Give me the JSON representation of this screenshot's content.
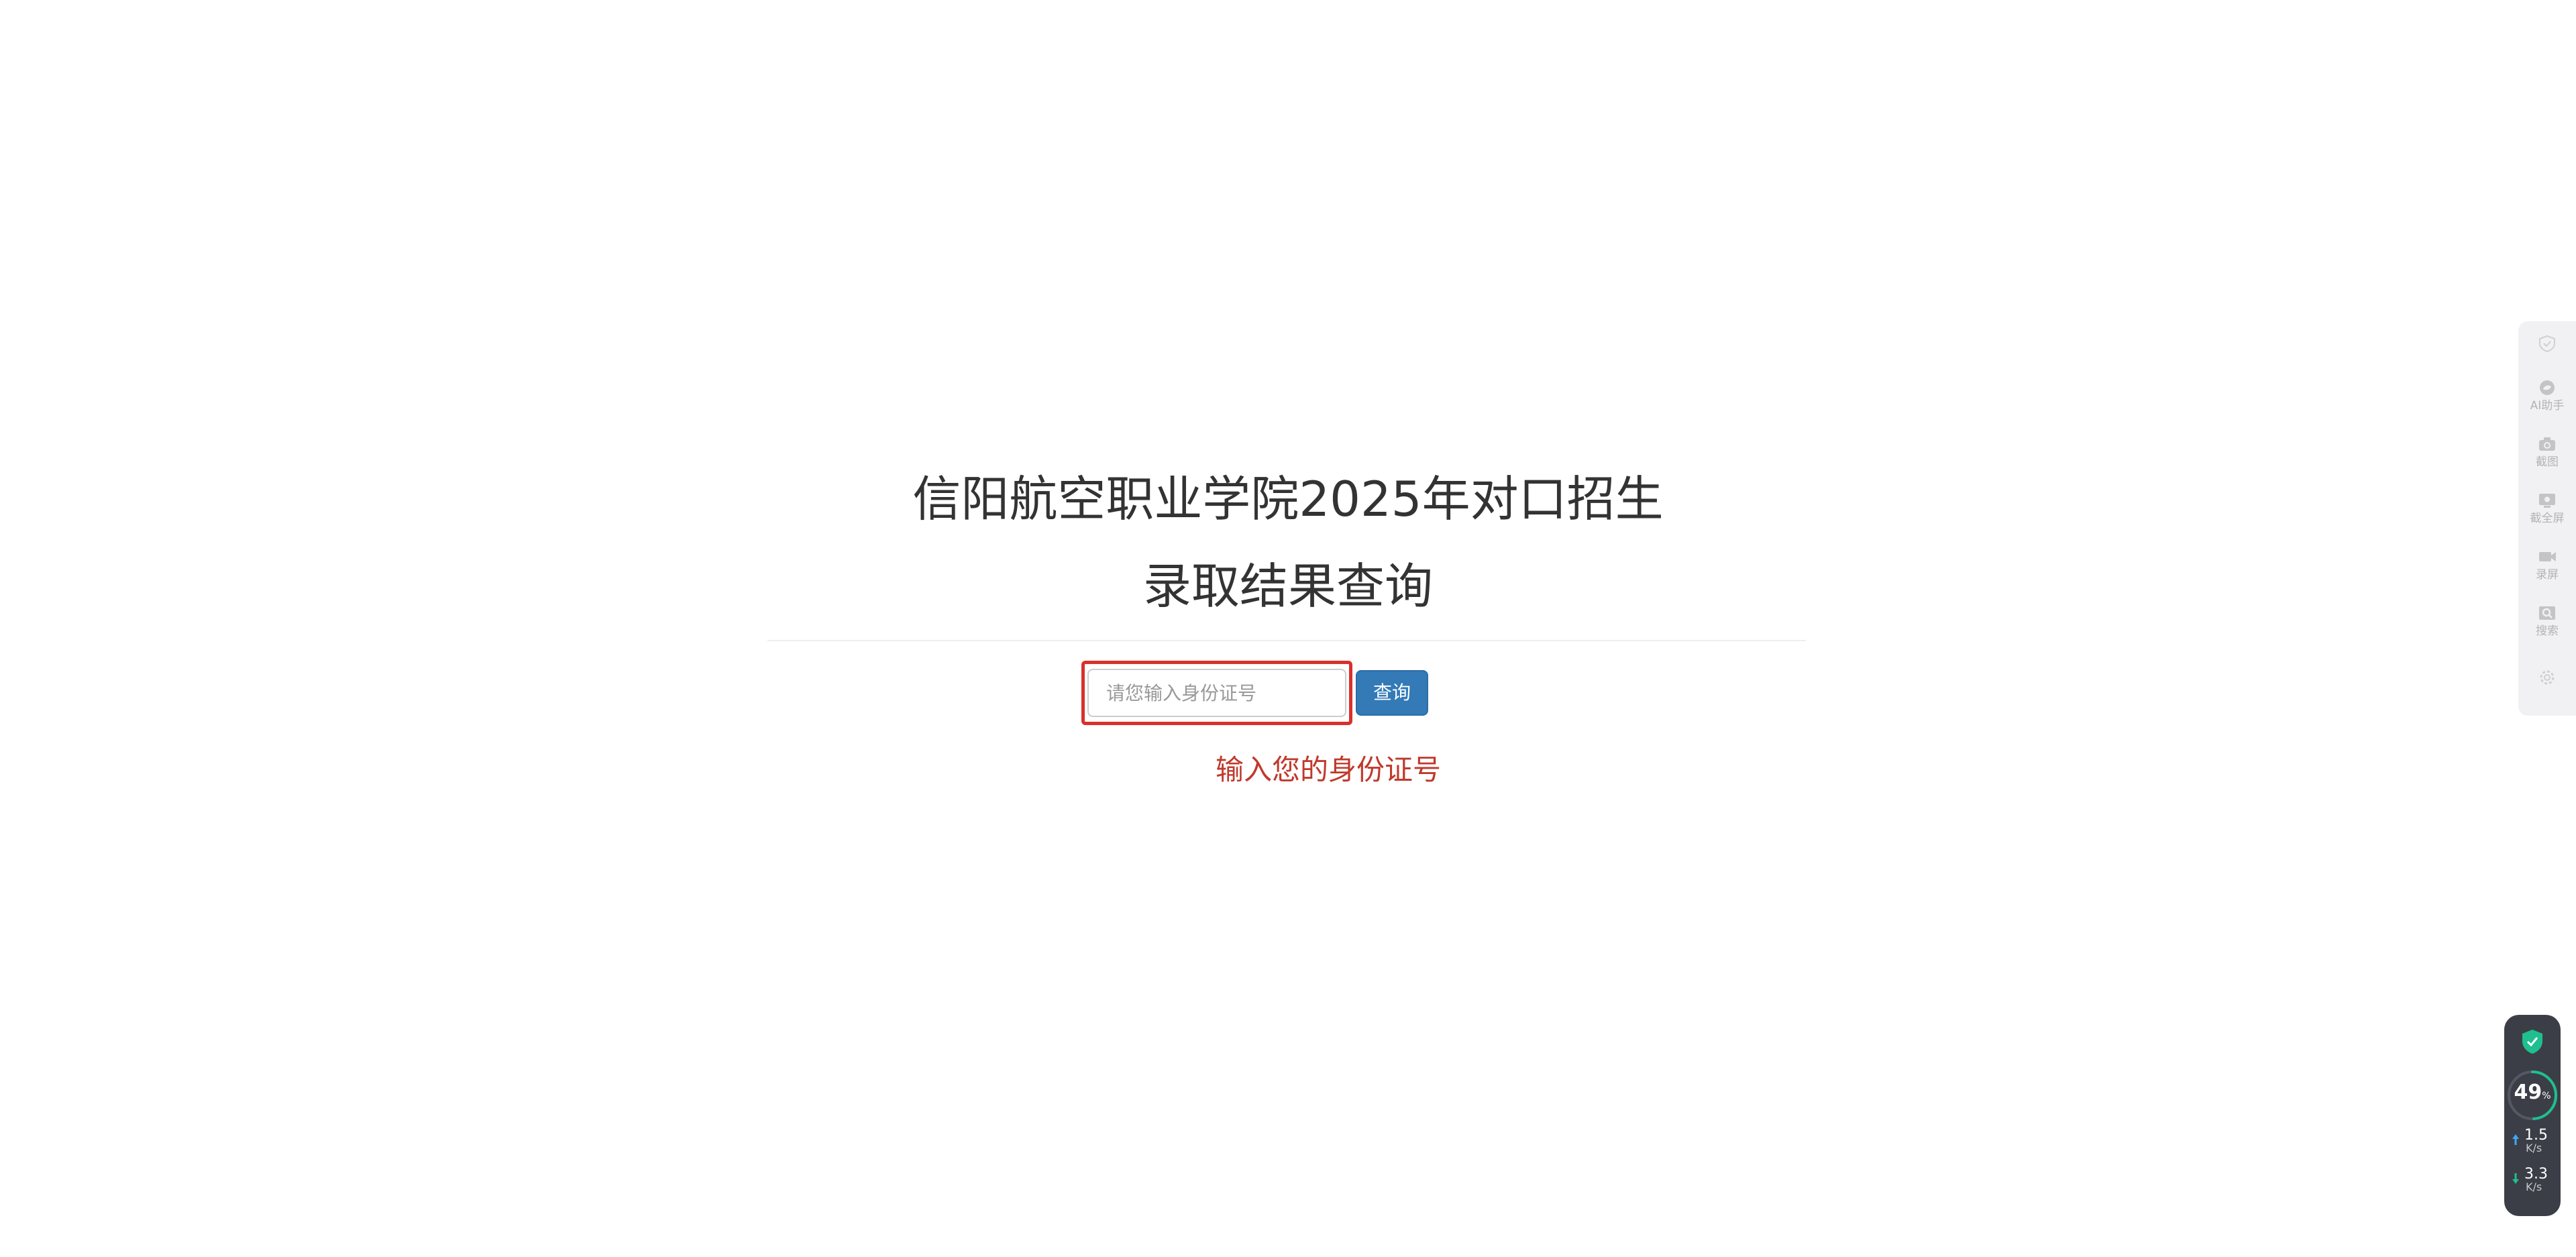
{
  "form": {
    "title_line1": "信阳航空职业学院2025年对口招生",
    "title_line2": "录取结果查询",
    "id_placeholder": "请您输入身份证号",
    "id_value": "",
    "query_button": "查询",
    "hint": "输入您的身份证号",
    "hint_color": "#c0392b",
    "button_color": "#337ab7",
    "highlight_color": "#d9302c"
  },
  "side_toolbar": {
    "items": [
      {
        "icon": "shield-outline-icon",
        "label": ""
      },
      {
        "icon": "ai-assistant-icon",
        "label": "AI助手"
      },
      {
        "icon": "camera-icon",
        "label": "截图"
      },
      {
        "icon": "screen-capture-icon",
        "label": "截全屏"
      },
      {
        "icon": "video-record-icon",
        "label": "录屏"
      },
      {
        "icon": "image-search-icon",
        "label": "搜索"
      },
      {
        "icon": "settings-icon",
        "label": ""
      }
    ]
  },
  "net_monitor": {
    "shield_icon": "security-check-icon",
    "cpu_percent": "49",
    "cpu_unit": "%",
    "upload_speed": "1.5",
    "upload_unit": "K/s",
    "download_speed": "3.3",
    "download_unit": "K/s",
    "accent_color": "#1fbf8f"
  }
}
